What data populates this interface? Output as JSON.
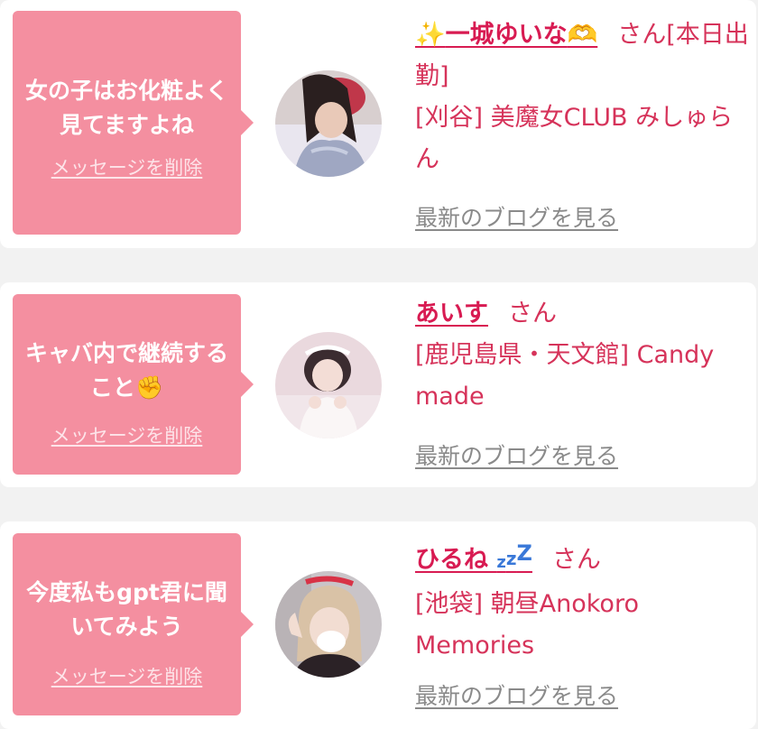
{
  "cards": [
    {
      "message": "女の子はお化粧よく見てますよね",
      "delete_label": "メッセージを削除",
      "name_prefix_emoji": "✨",
      "name": "一城ゆいな",
      "name_suffix_emoji": "🫶",
      "honorific": "さん",
      "status": "[本日出勤]",
      "shop": "[刈谷] 美魔女CLUB みしゅらん",
      "blog_label": "最新のブログを見る"
    },
    {
      "message": "キャバ内で継続すること",
      "message_emoji": "✊",
      "delete_label": "メッセージを削除",
      "name": "あいす",
      "honorific": "さん",
      "shop": "[鹿児島県・天文館] Candy made",
      "blog_label": "最新のブログを見る"
    },
    {
      "message": "今度私もgpt君に聞いてみよう",
      "delete_label": "メッセージを削除",
      "name": "ひるね",
      "name_suffix_emoji": "💤",
      "honorific": "さん",
      "shop": "[池袋] 朝昼Anokoro Memories",
      "blog_label": "最新のブログを見る"
    }
  ],
  "colors": {
    "bubble": "#f48fa0",
    "name": "#d81b52",
    "shop_text": "#d6335a",
    "blog_link": "#8a8a8a",
    "background": "#f2f2f2",
    "card": "#ffffff"
  },
  "icons": [
    "sparkles-icon",
    "heart-hands-icon",
    "raised-fist-icon",
    "zzz-icon"
  ]
}
